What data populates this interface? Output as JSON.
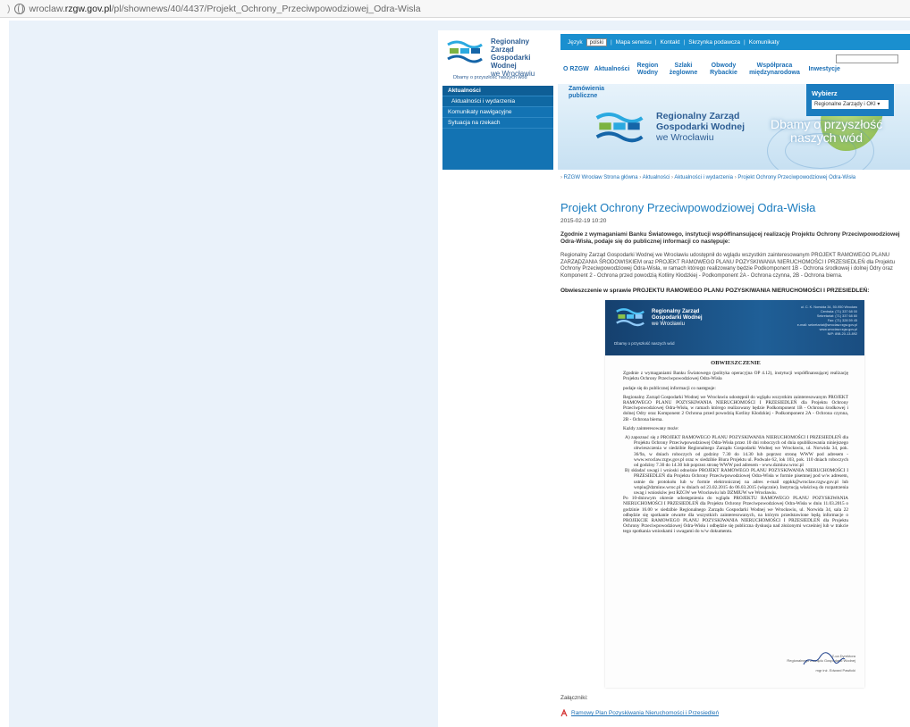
{
  "address_bar": {
    "prefix": "wroclaw.",
    "domain": "rzgw.gov.pl",
    "path": "/pl/shownews/40/4437/Projekt_Ochrony_Przeciwpowodziowej_Odra-Wisla"
  },
  "brand": {
    "name_line1": "Regionalny Zarząd",
    "name_line2": "Gospodarki Wodnej",
    "name_line3": "we Wrocławiu",
    "tagline": "Dbamy o przyszłość naszych wód"
  },
  "top_strip": {
    "language_label": "Język",
    "language_value": "polski",
    "items": [
      "Mapa serwisu",
      "Kontakt",
      "Skrzynka podawcza",
      "Komunikaty"
    ]
  },
  "main_nav": [
    "O RZGW",
    "Aktualności",
    "Region Wodny",
    "Szlaki żeglowne",
    "Obwody Rybackie",
    "Współpraca międzynarodowa",
    "Inwestycje"
  ],
  "sidebar": {
    "items": [
      {
        "label": "Aktualności",
        "kind": "head"
      },
      {
        "label": "Aktualności i wydarzenia",
        "kind": "sub"
      },
      {
        "label": "Komunikaty nawigacyjne",
        "kind": "item"
      },
      {
        "label": "Sytuacja na rzekach",
        "kind": "item"
      }
    ]
  },
  "banner": {
    "link_line1": "Zamówienia",
    "link_line2": "publiczne",
    "slogan_line1": "Dbamy o przyszłość",
    "slogan_line2": "naszych wód",
    "select_title": "Wybierz",
    "select_value": "Regionalne Zarządy i OKI"
  },
  "breadcrumb": [
    "RZGW Wrocław Strona główna",
    "Aktualności",
    "Aktualności i wydarzenia",
    "Projekt Ochrony Przeciwpowodziowej Odra-Wisła"
  ],
  "article": {
    "title": "Projekt Ochrony Przeciwpowodziowej Odra-Wisła",
    "date": "2015-02-19 10:20",
    "lead": "Zgodnie z wymaganiami Banku Światowego, instytucji współfinansującej realizację Projektu Ochrony Przeciwpowodziowej Odra-Wisła, podaje się do publicznej informacji co następuje:",
    "body": "Regionalny Zarząd Gospodarki Wodnej we Wrocławiu udostępnił do wglądu wszystkim zainteresowanym PROJEKT RAMOWEGO PLANU ZARZĄDZANIA ŚRODOWISKIEM oraz PROJEKT RAMOWEGO PLANU POZYSKIWANIA NIERUCHOMOŚCI I PRZESIEDLEŃ dla Projektu Ochrony Przeciwpowodziowej Odra-Wisła, w ramach którego realizowany będzie Podkomponent 1B - Ochrona środkowej i dolnej Odry oraz Komponent 2 - Ochrona przed powodzią Kotliny Kłodzkiej - Podkomponent 2A - Ochrona czynna, 2B - Ochrona bierna.",
    "subheading": "Obwieszczenie w sprawie PROJEKTU RAMOWEGO PLANU POZYSKIWANIA NIERUCHOMOŚCI I PRZESIEDLEŃ:"
  },
  "document": {
    "contact_lines": [
      "ul. C. K. Norwida 34, 50-950 Wrocław",
      "Centrala: (71) 337 68 00",
      "Sekretariat: (71) 337 68 80",
      "Fax: (71) 328 59 45",
      "e-mail: sekretariat@wroclaw.rzgw.gov.pl",
      "www.wroclaw.rzgw.gov.pl",
      "NIP: 898-20-13-892"
    ],
    "title": "OBWIESZCZENIE",
    "p1": "Zgodnie z wymaganiami Banku Światowego (polityka operacyjna OP 4.12), instytucji współfinansującej realizację Projektu Ochrony Przeciwpowodziowej Odra-Wisła",
    "p2": "podaje się do publicznej informacji co następuje:",
    "p3": "Regionalny Zarząd Gospodarki Wodnej we Wrocławiu udostępnił do wglądu wszystkim zainteresowanym PROJEKT RAMOWEGO PLANU POZYSKIWANIA NIERUCHOMOŚCI I PRZESIEDLEŃ dla Projektu Ochrony Przeciwpowodziowej Odra-Wisła, w ramach którego realizowany będzie Podkomponent 1B - Ochrona środkowej i dolnej Odry oraz Komponent 2 Ochrona przed powodzią Kotliny Kłodzkiej - Podkomponent 2A - Ochrona czynna, 2B - Ochrona bierna.",
    "p4": "Każdy zainteresowany może:",
    "a": "A) zapoznać się z PROJEKT RAMOWEGO PLANU POZYSKIWANIA NIERUCHOMOŚCI I PRZESIEDLEŃ dla Projektu Ochrony Przeciwpowodziowej Odra-Wisła przez 10 dni roboczych od dnia opublikowania niniejszego obwieszczenia w siedzibie Regionalnego Zarządu Gospodarki Wodnej we Wrocławiu, ul. Norwida 34, pok. 36/9a, w dniach roboczych od godziny 7.30 do 14.30 lub poprzez stronę WWW pod adresem - www.wroclaw.rzgw.gov.pl oraz w siedzibie Biura Projektu ul. Podwale 62, lok 103, pok. 110 dniach roboczych od godziny 7.30 do 14.30 lub poprzez stronę WWW pod adresem - www.dzmiuw.wroc.pl",
    "b": "B) składać uwagi i wnioski odnośnie PROJEKT RAMOWEGO PLANU POZYSKIWANIA NIERUCHOMOŚCI I PRZESIEDLEŃ dla Projektu Ochrony Przeciwpowodziowej Odra-Wisła w formie pisemnej pod w/w adresem, ustnie do protokołu lub w formie elektronicznej na adres e-mail oppkk@wroclaw.rzgw.gov.pl lub wnpiu@dzmiuw.wroc.pl w dniach od 23.02.2015 do 06.03.2015 (włącznie). Instytucją właściwą do rozpatrzenia uwag i wniosków jest RZGW we Wrocławiu lub DZMIUW we Wrocławiu.",
    "p5": "Po 10-dniowym okresie udostępnienia do wglądu PROJEKTU RAMOWEGO PLANU POZYSKIWANIA NIERUCHOMOŚCI I PRZESIEDLEŃ dla Projektu Ochrony Przeciwpowodziowej Odra-Wisła w dniu 11.03.2015 o godzinie 16.00 w siedzibie Regionalnego Zarządu Gospodarki Wodnej we Wrocławiu, ul. Norwida 34, sala 22 odbędzie się spotkanie otwarte dla wszystkich zainteresowanych, na którym przedstawione będą informacje o PROJEKCIE RAMOWEGO PLANU POZYSKIWANIA NIERUCHOMOŚCI I PRZESIEDLEŃ dla Projektu Ochrony Przeciwpowodziowej Odra-Wisła i odbędzie się publiczna dyskusja nad złożonymi wcześniej lub w trakcie tego spotkania wnioskami i uwagami do w/w dokumentu.",
    "sign_line1": "Z-ca Dyrektora",
    "sign_line2": "Regionalnego Zarządu Gospodarki Wodnej",
    "sign_line3": "mgr inż. Edward Pawlicki"
  },
  "attachments": {
    "label": "Załączniki:",
    "items": [
      "Ramowy Plan Pozyskiwania Nieruchomości i Przesiedleń"
    ]
  },
  "colors": {
    "accent_blue": "#1b7cbf",
    "nav_blue": "#1373b3",
    "leaf_green": "#78ad2f"
  }
}
